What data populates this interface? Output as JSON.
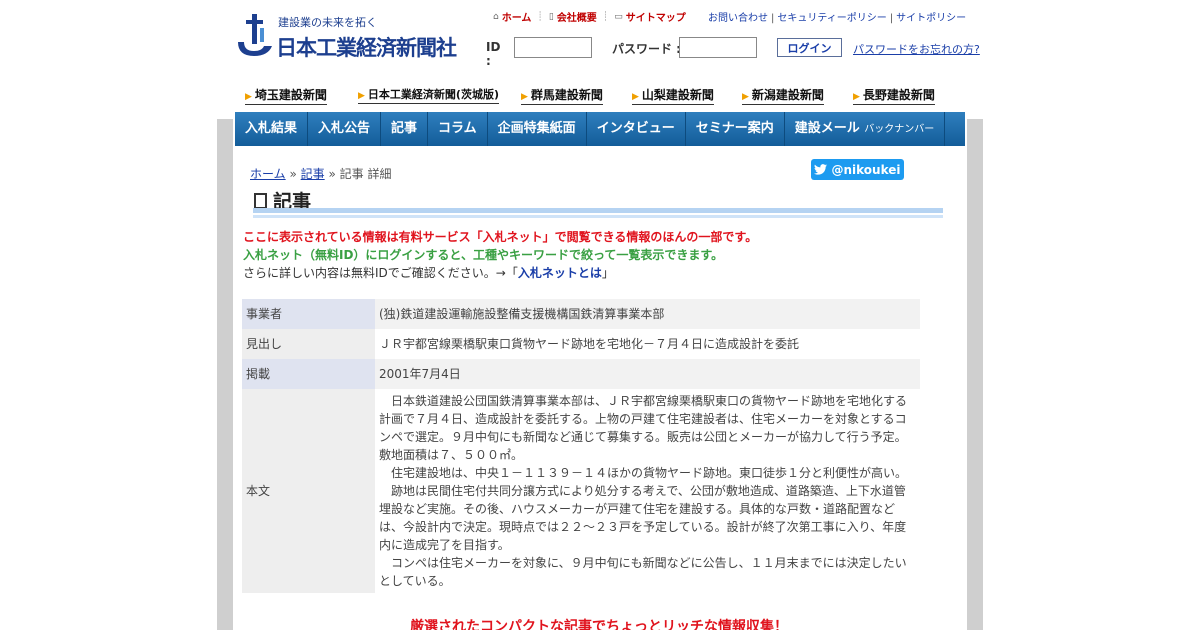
{
  "header": {
    "logo_tagline": "建設業の未来を拓く",
    "logo_name": "日本工業経済新聞社",
    "util_nav": [
      {
        "icon": "home-icon",
        "glyph": "⌂",
        "label": "ホーム"
      },
      {
        "icon": "document-icon",
        "glyph": "▯",
        "label": "会社概要"
      },
      {
        "icon": "sitemap-icon",
        "glyph": "▭",
        "label": "サイトマップ"
      }
    ],
    "util_links": [
      "お問い合わせ",
      "セキュリティーポリシー",
      "サイトポリシー"
    ],
    "login": {
      "id_label": "ID :",
      "password_label": "パスワード :",
      "id_value": "",
      "password_value": "",
      "login_button": "ログイン",
      "forgot_link": "パスワードをお忘れの方?"
    }
  },
  "papers": [
    "埼玉建設新聞",
    "日本工業経済新聞(茨城版)",
    "群馬建設新聞",
    "山梨建設新聞",
    "新潟建設新聞",
    "長野建設新聞"
  ],
  "main_nav": [
    {
      "label": "入札結果",
      "sub": ""
    },
    {
      "label": "入札公告",
      "sub": ""
    },
    {
      "label": "記事",
      "sub": ""
    },
    {
      "label": "コラム",
      "sub": ""
    },
    {
      "label": "企画特集紙面",
      "sub": ""
    },
    {
      "label": "インタビュー",
      "sub": ""
    },
    {
      "label": "セミナー案内",
      "sub": ""
    },
    {
      "label": "建設メール",
      "sub": "バックナンバー"
    }
  ],
  "breadcrumb": {
    "home": "ホーム",
    "sep1": "»",
    "articles": "記事",
    "sep2": "»",
    "current": "記事 詳細"
  },
  "twitter": {
    "handle": "@nikoukei"
  },
  "page_title": "記事",
  "notices": {
    "line1": "ここに表示されている情報は有料サービス「入札ネット」で閲覧できる情報のほんの一部です。",
    "line2": "入札ネット（無料ID）にログインすると、工種やキーワードで絞って一覧表示できます。",
    "line3_prefix": "さらに詳しい内容は無料IDでご確認ください。→「",
    "line3_link": "入札ネットとは",
    "line3_suffix": "」"
  },
  "article": {
    "rows": [
      {
        "key": "事業者",
        "value": "(独)鉄道建設運輸施設整備支援機構国鉄清算事業本部"
      },
      {
        "key": "見出し",
        "value": "ＪＲ宇都宮線栗橋駅東口貨物ヤード跡地を宅地化－７月４日に造成設計を委託"
      },
      {
        "key": "掲載",
        "value": "2001年7月4日"
      },
      {
        "key": "本文",
        "value": "　日本鉄道建設公団国鉄清算事業本部は、ＪＲ宇都宮線栗橋駅東口の貨物ヤード跡地を宅地化する計画で７月４日、造成設計を委託する。上物の戸建て住宅建設者は、住宅メーカーを対象とするコンペで選定。９月中旬にも新聞など通じて募集する。販売は公団とメーカーが協力して行う予定。敷地面積は７、５００㎡。\n　住宅建設地は、中央１－１１３９－１４ほかの貨物ヤード跡地。東口徒歩１分と利便性が高い。\n　跡地は民間住宅付共同分譲方式により処分する考えで、公団が敷地造成、道路築造、上下水道管埋設など実施。その後、ハウスメーカーが戸建て住宅を建設する。具体的な戸数・道路配置などは、今設計内で決定。現時点では２２～２３戸を予定している。設計が終了次第工事に入り、年度内に造成完了を目指す。\n　コンペは住宅メーカーを対象に、９月中旬にも新聞などに公告し、１１月末までには決定したいとしている。"
      }
    ]
  },
  "promo": "厳選されたコンパクトな記事でちょっとリッチな情報収集！",
  "colors": {
    "nav_blue": "#1f6aa8",
    "notice_red": "#e0141e",
    "notice_green": "#3aa043",
    "twitter_blue": "#1d9bf0"
  }
}
